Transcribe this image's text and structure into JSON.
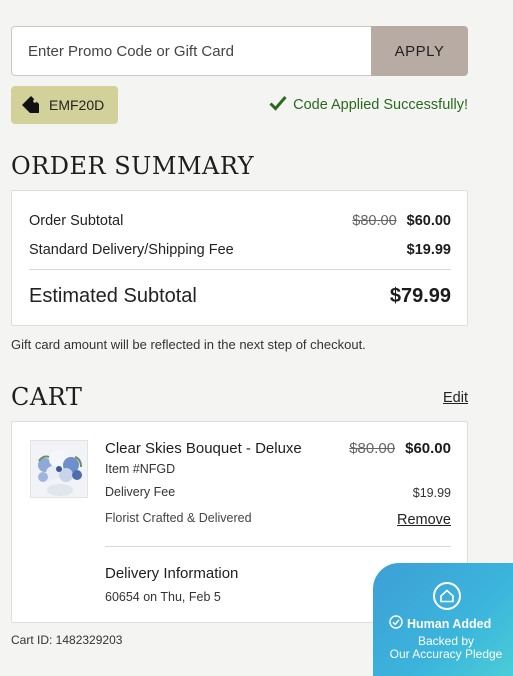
{
  "promo": {
    "placeholder": "Enter Promo Code or Gift Card",
    "value": "",
    "apply_label": "APPLY",
    "applied_code": "EMF20D",
    "success_message": "Code Applied Successfully!"
  },
  "order_summary": {
    "title": "ORDER SUMMARY",
    "subtotal_label": "Order Subtotal",
    "subtotal_original": "$80.00",
    "subtotal_price": "$60.00",
    "shipping_label": "Standard Delivery/Shipping Fee",
    "shipping_price": "$19.99",
    "estimated_label": "Estimated Subtotal",
    "estimated_price": "$79.99",
    "gift_card_note": "Gift card amount will be reflected in the next step of checkout."
  },
  "cart": {
    "title": "CART",
    "edit_label": "Edit",
    "item": {
      "name": "Clear Skies Bouquet - Deluxe",
      "item_number": "Item #NFGD",
      "original_price": "$80.00",
      "price": "$60.00",
      "fee_label": "Delivery Fee",
      "fee_value": "$19.99",
      "florist_note": "Florist Crafted & Delivered",
      "remove_label": "Remove"
    },
    "delivery_title": "Delivery Information",
    "delivery_detail": "60654 on Thu, Feb 5",
    "cart_id": "Cart ID: 1482329203"
  },
  "badge": {
    "title": "Human Added",
    "line1": "Backed by",
    "line2": "Our Accuracy Pledge"
  },
  "colors": {
    "apply_button": "#b8aba3",
    "code_chip": "#d3d19a",
    "success_green": "#2a6a1f",
    "badge_gradient_start": "#3e9fd6",
    "badge_gradient_end": "#4fd3d6"
  },
  "icons": [
    "tag-icon",
    "check-icon",
    "home-shield-icon",
    "verified-check-icon"
  ]
}
